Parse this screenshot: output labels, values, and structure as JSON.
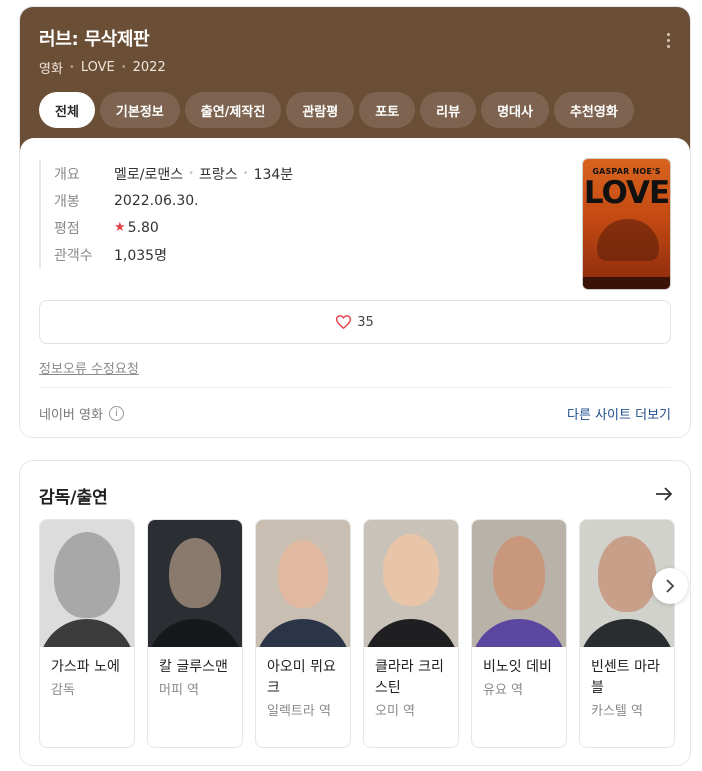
{
  "movie": {
    "title": "러브: 무삭제판",
    "type": "영화",
    "original_title": "LOVE",
    "year": "2022"
  },
  "tabs": [
    "전체",
    "기본정보",
    "출연/제작진",
    "관람평",
    "포토",
    "리뷰",
    "명대사",
    "추천영화"
  ],
  "facts": {
    "summary_label": "개요",
    "genre": "멜로/로맨스",
    "country": "프랑스",
    "runtime": "134분",
    "release_label": "개봉",
    "release_date": "2022.06.30.",
    "rating_label": "평점",
    "rating": "5.80",
    "audience_label": "관객수",
    "audience": "1,035명"
  },
  "poster": {
    "top_text": "GASPAR NOE'S",
    "big_text": "LOVE"
  },
  "likes": "35",
  "report_link": "정보오류 수정요청",
  "source": "네이버 영화",
  "other_sites": "다른 사이트 더보기",
  "cast_section": {
    "title": "감독/출연",
    "people": [
      {
        "name": "가스파 노에",
        "role": "감독"
      },
      {
        "name": "칼 글루스맨",
        "role": "머피 역"
      },
      {
        "name": "아오미 뮈요크",
        "role": "일렉트라 역"
      },
      {
        "name": "클라라 크리스틴",
        "role": "오미 역"
      },
      {
        "name": "비노잇 데비",
        "role": "유요 역"
      },
      {
        "name": "빈센트 마라블",
        "role": "카스텔 역"
      }
    ]
  },
  "colors": {
    "header_bg": "#6b4e36",
    "link": "#1f4e8c",
    "star": "#e8404a"
  }
}
